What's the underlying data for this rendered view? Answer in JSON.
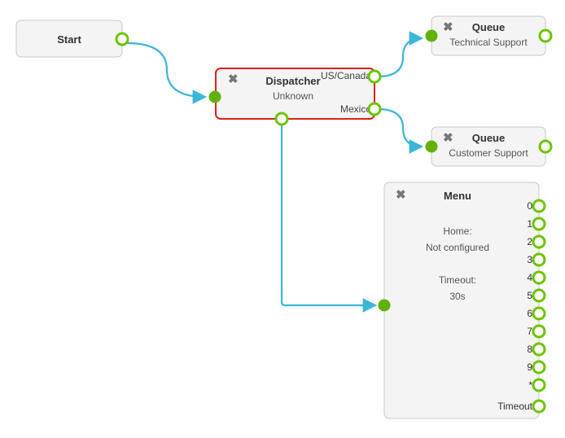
{
  "start": {
    "title": "Start"
  },
  "dispatcher": {
    "title": "Dispatcher",
    "subtitle": "Unknown",
    "port_us": "US/Canada",
    "port_mexico": "Mexico"
  },
  "queue_tech": {
    "title": "Queue",
    "subtitle": "Technical Support"
  },
  "queue_cust": {
    "title": "Queue",
    "subtitle": "Customer Support"
  },
  "menu": {
    "title": "Menu",
    "home_label": "Home:",
    "home_value": "Not configured",
    "timeout_label": "Timeout:",
    "timeout_value": "30s",
    "options": [
      "0",
      "1",
      "2",
      "3",
      "4",
      "5",
      "6",
      "7",
      "8",
      "9",
      "*",
      "Timeout"
    ]
  },
  "colors": {
    "port_green": "#6cc400",
    "port_solid": "#5fb200",
    "connector": "#3cb6d7",
    "selected": "#d9221b"
  }
}
